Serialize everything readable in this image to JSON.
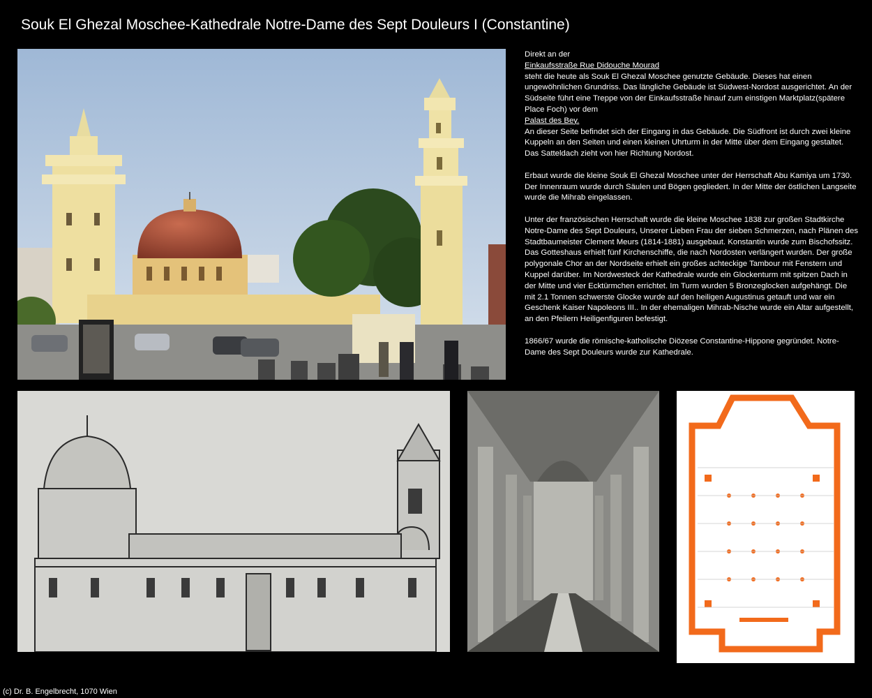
{
  "title": "Souk El Ghezal Moschee-Kathedrale Notre-Dame des Sept Douleurs I (Constantine)",
  "text": {
    "p1_a": "Direkt an der",
    "p1_link1": "Einkaufsstraße Rue Didouche Mourad",
    "p1_b": "steht die heute als Souk El Ghezal Moschee genutzte Gebäude. Dieses hat einen ungewöhnlichen Grundriss. Das längliche Gebäude ist Südwest-Nordost ausgerichtet. An der Südseite führt eine Treppe von der Einkaufsstraße hinauf zum einstigen Marktplatz(spätere Place Foch) vor dem",
    "p1_link2": "Palast des Bey.",
    "p1_c": "An dieser Seite befindet sich der Eingang in das Gebäude. Die Südfront ist durch zwei kleine Kuppeln an den Seiten und einen kleinen Uhrturm in der Mitte über dem Eingang gestaltet. Das Satteldach zieht von hier Richtung Nordost.",
    "p2": "Erbaut wurde die kleine Souk El Ghezal Moschee unter der Herrschaft Abu Kamiya um 1730. Der Innenraum wurde durch Säulen und Bögen gegliedert. In der Mitte der östlichen Langseite wurde die Mihrab eingelassen.",
    "p3": "Unter der französischen Herrschaft wurde die kleine Moschee 1838 zur großen Stadtkirche Notre-Dame des Sept Douleurs, Unserer Lieben Frau der sieben Schmerzen, nach Plänen des Stadtbaumeister Clement Meurs (1814-1881) ausgebaut. Konstantin wurde zum Bischofssitz. Das Gotteshaus erhielt fünf Kirchenschiffe, die nach Nordosten verlängert wurden. Der große polygonale Chor an der Nordseite erhielt ein großes achteckige Tambour mit Fenstern und Kuppel darüber. Im Nordwesteck der Kathedrale wurde ein Glockenturm mit spitzen Dach in der Mitte und vier Ecktürmchen errichtet. Im Turm wurden 5 Bronzeglocken aufgehängt. Die mit 2.1 Tonnen schwerste Glocke wurde auf den heiligen Augustinus getauft und war ein Geschenk Kaiser Napoleons III.. In der ehemaligen Mihrab-Nische wurde ein Altar aufgestellt, an den Pfeilern Heiligenfiguren befestigt.",
    "p4": "1866/67 wurde die römische-katholische Diözese Constantine-Hippone gegründet. Notre-Dame des Sept Douleurs wurde zur Kathedrale."
  },
  "footer": "(c) Dr. B. Engelbrecht, 1070 Wien",
  "colors": {
    "background": "#000000",
    "text": "#ffffff",
    "plan_orange": "#f26a1b"
  }
}
